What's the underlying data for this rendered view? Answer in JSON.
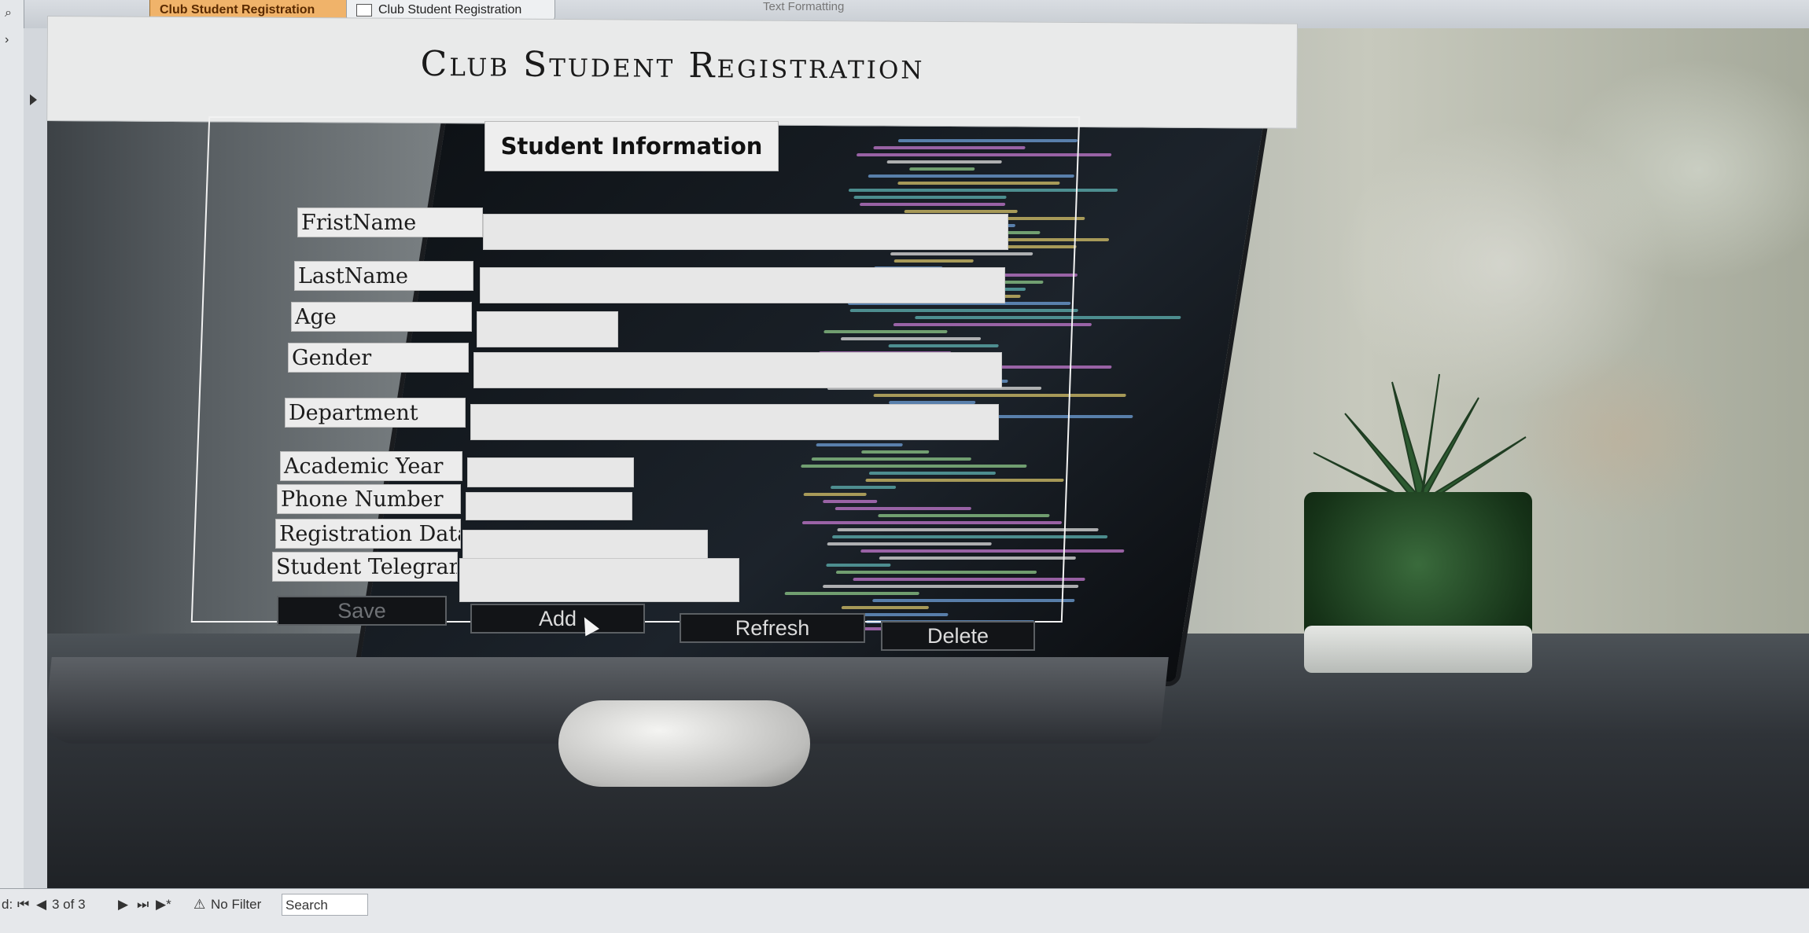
{
  "tabs": [
    {
      "label": "Club Student Registration",
      "active": true
    },
    {
      "label": "Club Student Registration",
      "active": false
    }
  ],
  "ribbon_partial": "Text Formatting",
  "form": {
    "title": "Club Student Registration",
    "section_title": "Student Information",
    "fields": [
      {
        "label": "FristName",
        "value": ""
      },
      {
        "label": "LastName",
        "value": ""
      },
      {
        "label": "Age",
        "value": ""
      },
      {
        "label": "Gender",
        "value": ""
      },
      {
        "label": "Department",
        "value": ""
      },
      {
        "label": "Academic Year",
        "value": ""
      },
      {
        "label": "Phone Number",
        "value": ""
      },
      {
        "label": "Registration Data",
        "value": ""
      },
      {
        "label": "Student Telegram",
        "value": ""
      }
    ],
    "buttons": {
      "save": "Save",
      "add": "Add",
      "refresh": "Refresh",
      "delete": "Delete"
    }
  },
  "navigator": {
    "prefix": "d:",
    "first": "⏮",
    "prev": "◀",
    "record": "3 of 3",
    "next": "▶",
    "last": "⏭",
    "new_record": "▶*",
    "filter": "No Filter",
    "search": "Search"
  },
  "colors": {
    "active_tab": "#f0b36a",
    "button_bg": "#121417",
    "field_bg": "#e7e7e7"
  }
}
